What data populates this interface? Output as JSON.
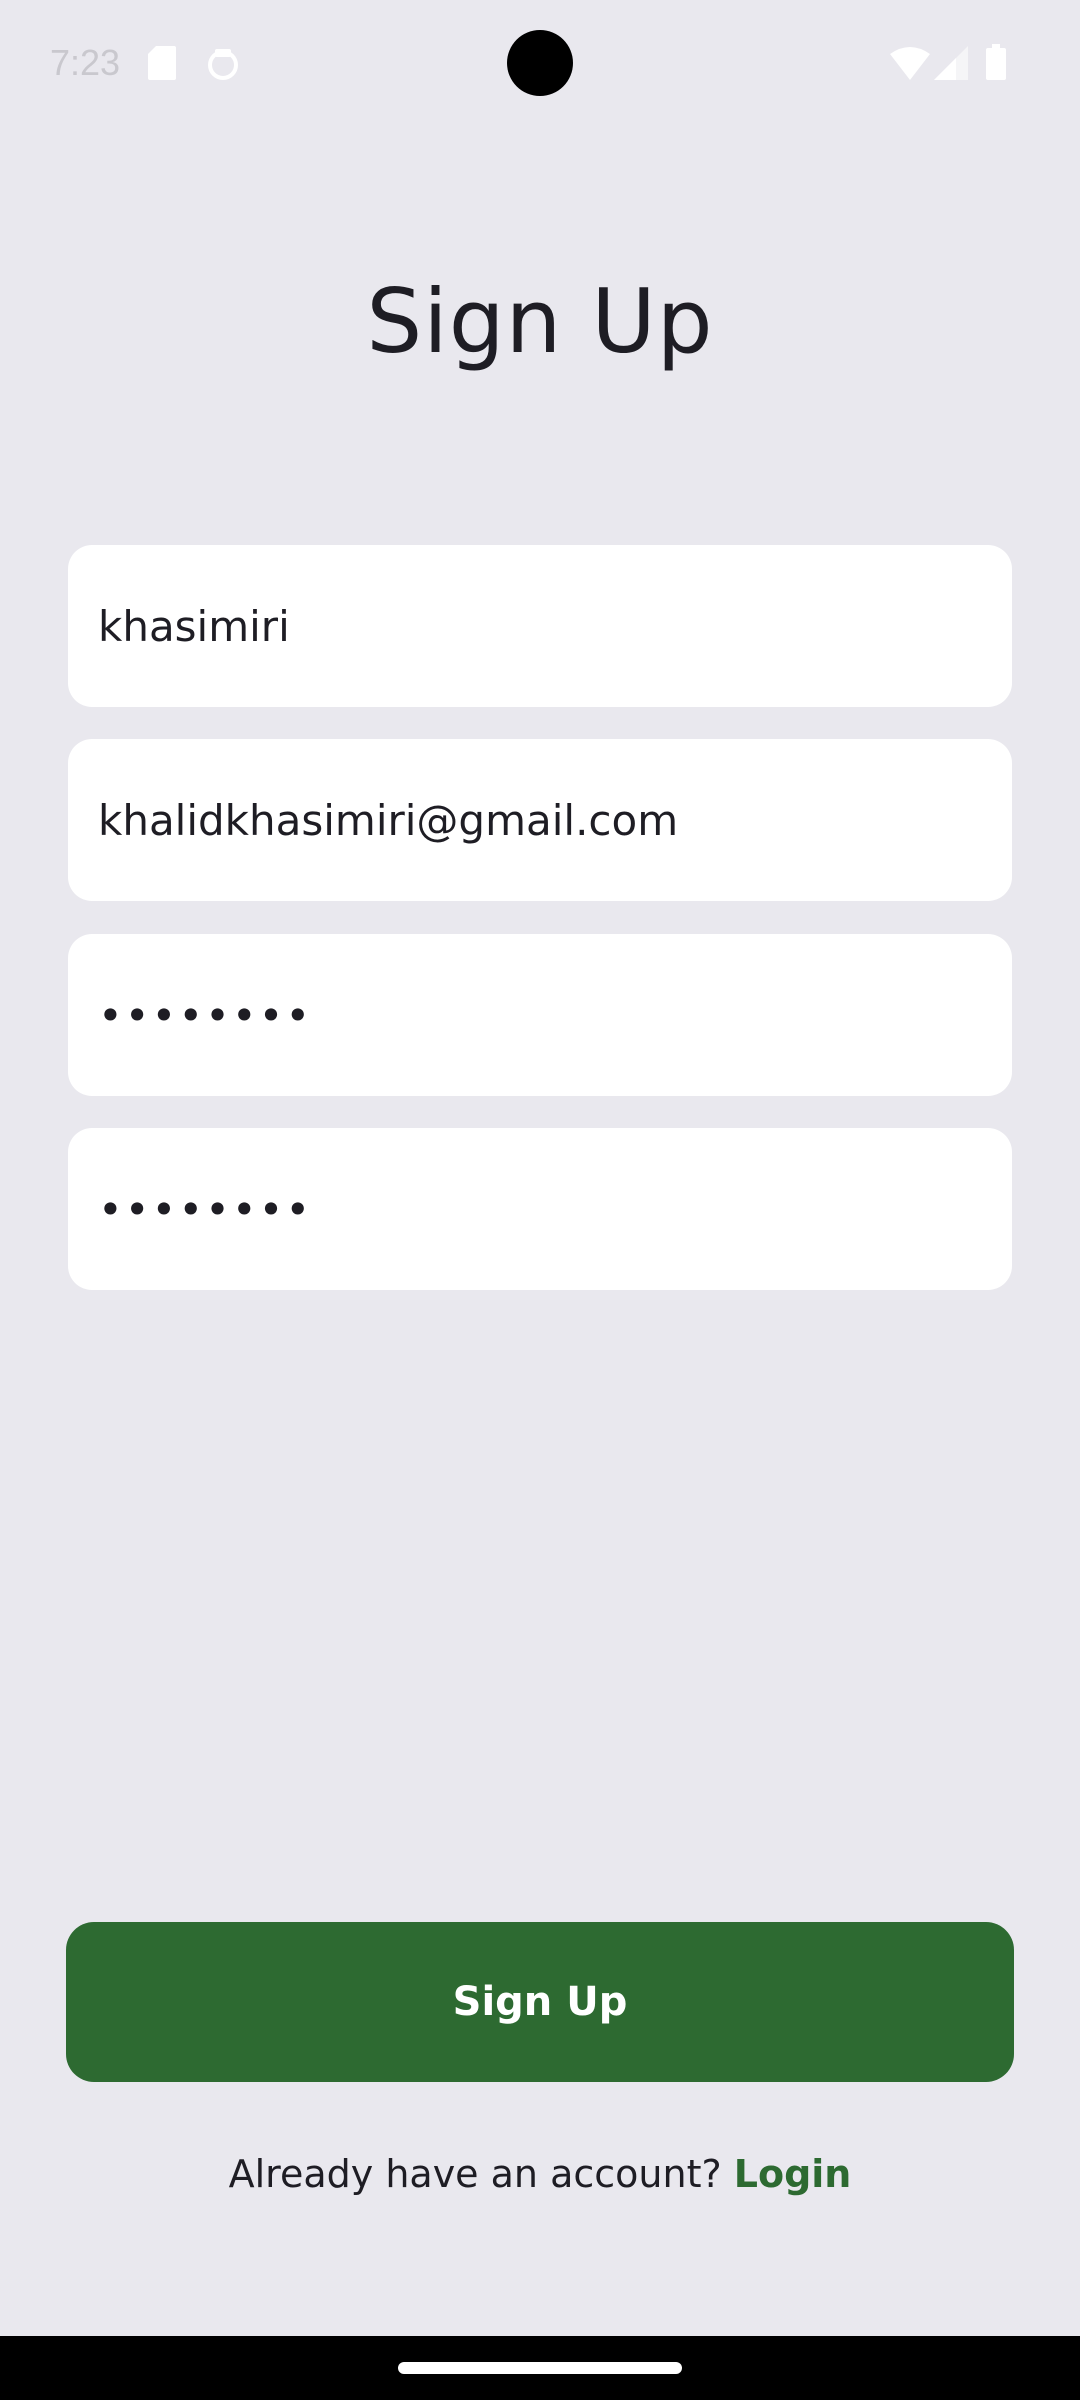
{
  "status_bar": {
    "time": "7:23",
    "icons": [
      "sd-card-icon",
      "app-notification-icon",
      "wifi-icon",
      "cell-signal-icon",
      "battery-icon"
    ]
  },
  "page": {
    "title": "Sign Up"
  },
  "form": {
    "username_value": "khasimiri",
    "email_value": "khalidkhasimiri@gmail.com",
    "password_value": "••••••••",
    "confirm_password_value": "••••••••"
  },
  "actions": {
    "signup_label": "Sign Up",
    "login_prompt": "Already have an account?",
    "login_link": "Login"
  },
  "colors": {
    "background": "#e9e8ee",
    "accent_green": "#2d6a31",
    "field_bg": "#ffffff",
    "text": "#1e1d24"
  }
}
